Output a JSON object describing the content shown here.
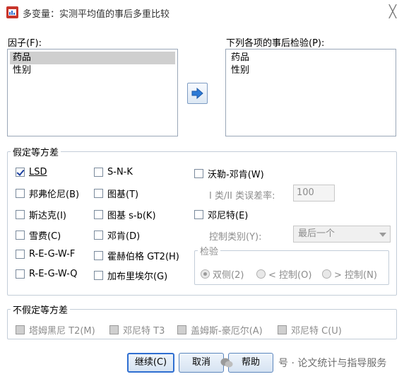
{
  "window": {
    "title": "多变量：实测平均值的事后多重比较",
    "close_glyph": "╳"
  },
  "factors": {
    "label": "因子(F):",
    "items": [
      "药品",
      "性别"
    ]
  },
  "posthoc": {
    "label": "下列各项的事后检验(P):",
    "items": [
      "药品",
      "性别"
    ]
  },
  "equal_var": {
    "legend": "假定等方差",
    "lsd": "LSD",
    "bonferroni": "邦弗伦尼(B)",
    "sidak": "斯达克(I)",
    "scheffe": "雪费(C)",
    "regwf": "R-E-G-W-F",
    "regwq": "R-E-G-W-Q",
    "snk": "S-N-K",
    "tukey": "图基(T)",
    "tukeyb": "图基 s-b(K)",
    "duncan": "邓肯(D)",
    "hochberg": "霍赫伯格 GT2(H)",
    "gabriel": "加布里埃尔(G)",
    "waller": "沃勒-邓肯(W)",
    "error_ratio_label": "I 类/II 类误差率:",
    "error_ratio_value": "100",
    "dunnett": "邓尼特(E)",
    "control_label": "控制类别(Y):",
    "control_value": "最后一个",
    "test_legend": "检验",
    "two_sided": "双侧(2)",
    "lt_control": "< 控制(O)",
    "gt_control": "> 控制(N)"
  },
  "unequal_var": {
    "legend": "不假定等方差",
    "tamhane": "塔姆黑尼 T2(M)",
    "dunnett_t3": "邓尼特 T3",
    "games_howell": "盖姆斯-豪厄尔(A)",
    "dunnett_c": "邓尼特 C(U)"
  },
  "buttons": {
    "continue": "继续(C)",
    "cancel": "取消",
    "help": "帮助"
  },
  "watermark": "号 · 论文统计与指导服务",
  "colors": {
    "accent": "#2f6fd1",
    "check": "#1a3fa0",
    "arrow_button": "#2e7bd6"
  }
}
